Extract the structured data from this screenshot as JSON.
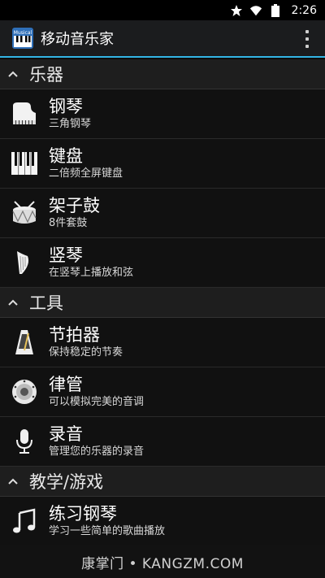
{
  "status_bar": {
    "time": "2:26",
    "icons": [
      "star-icon",
      "wifi-icon",
      "battery-icon"
    ]
  },
  "app": {
    "title": "移动音乐家",
    "icon_label": "Musical"
  },
  "sections": [
    {
      "title": "乐器",
      "items": [
        {
          "name": "钢琴",
          "desc": "三角钢琴",
          "icon": "piano-icon"
        },
        {
          "name": "键盘",
          "desc": "二倍频全屏键盘",
          "icon": "keyboard-icon"
        },
        {
          "name": "架子鼓",
          "desc": "8件套鼓",
          "icon": "drum-icon"
        },
        {
          "name": "竖琴",
          "desc": "在竖琴上播放和弦",
          "icon": "harp-icon"
        }
      ]
    },
    {
      "title": "工具",
      "items": [
        {
          "name": "节拍器",
          "desc": "保持稳定的节奏",
          "icon": "metronome-icon"
        },
        {
          "name": "律管",
          "desc": "可以模拟完美的音调",
          "icon": "pitch-pipe-icon"
        },
        {
          "name": "录音",
          "desc": "管理您的乐器的录音",
          "icon": "microphone-icon"
        }
      ]
    },
    {
      "title": "教学/游戏",
      "items": [
        {
          "name": "练习钢琴",
          "desc": "学习一些简单的歌曲播放",
          "icon": "music-note-icon"
        }
      ]
    }
  ],
  "footer": {
    "watermark": "康掌门 • KANGZM.COM"
  },
  "colors": {
    "accent": "#33b5e5",
    "background": "#0d0d0d",
    "section_bg": "#1e1e1e"
  }
}
